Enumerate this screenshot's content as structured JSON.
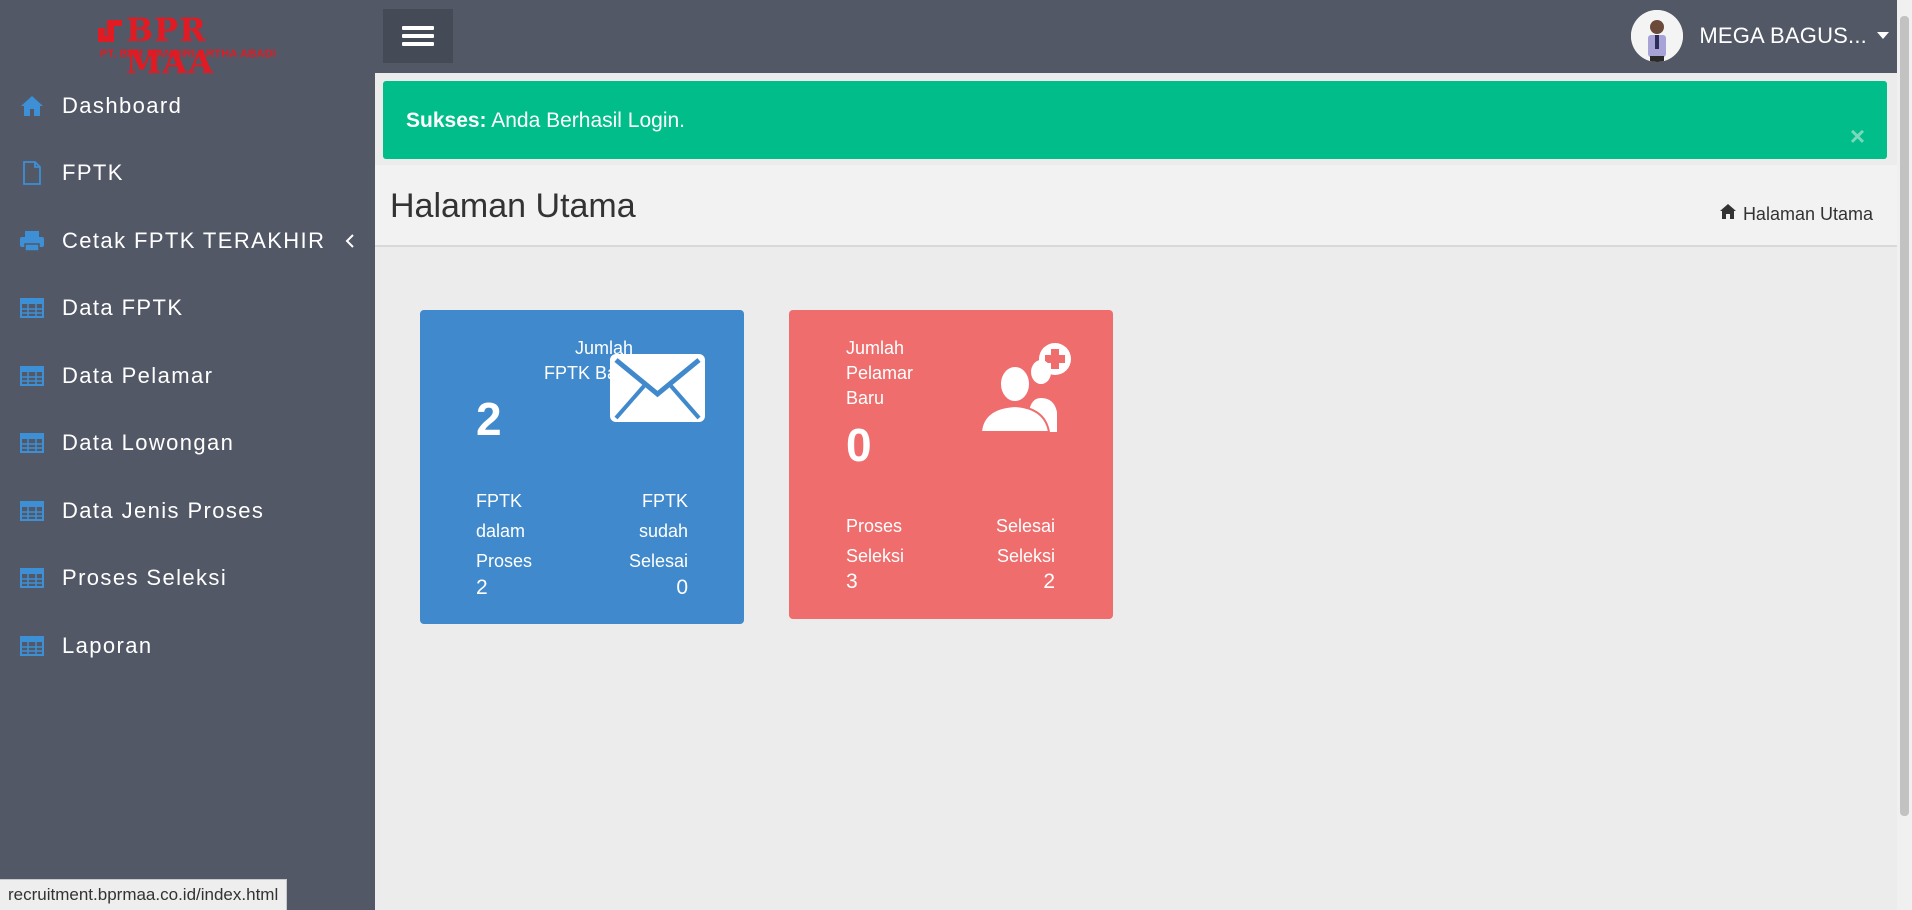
{
  "app": {
    "logo_title": "BPR MAA",
    "logo_subtitle": "PT. BPR MANDIRI ARTHA ABADI"
  },
  "colors": {
    "sidebar_bg": "#525866",
    "accent_icon": "#3d8fd6",
    "success": "#00bd8a",
    "card_blue": "#3f89cc",
    "card_red": "#ef6d6d"
  },
  "sidebar": {
    "items": [
      {
        "label": "Dashboard",
        "icon": "home-icon"
      },
      {
        "label": "FPTK",
        "icon": "file-icon"
      },
      {
        "label": "Cetak FPTK TERAKHIR",
        "icon": "printer-icon"
      },
      {
        "label": "Data FPTK",
        "icon": "table-icon"
      },
      {
        "label": "Data Pelamar",
        "icon": "table-icon"
      },
      {
        "label": "Data Lowongan",
        "icon": "table-icon"
      },
      {
        "label": "Data Jenis Proses",
        "icon": "table-icon"
      },
      {
        "label": "Proses Seleksi",
        "icon": "table-icon"
      },
      {
        "label": "Laporan",
        "icon": "table-icon"
      }
    ]
  },
  "topbar": {
    "user_name": "MEGA BAGUS..."
  },
  "alert": {
    "strong": "Sukses:",
    "message": " Anda Berhasil Login.",
    "close": "×"
  },
  "header": {
    "title": "Halaman Utama",
    "breadcrumb": "Halaman Utama"
  },
  "cards": {
    "fptk": {
      "title_line1": "Jumlah",
      "title_line2": "FPTK Baru",
      "count": "2",
      "left_label": [
        "FPTK",
        "dalam",
        "Proses"
      ],
      "left_value": "2",
      "right_label": [
        "FPTK",
        "sudah",
        "Selesai"
      ],
      "right_value": "0"
    },
    "pelamar": {
      "title_line1": "Jumlah",
      "title_line2": "Pelamar",
      "title_line3": "Baru",
      "count": "0",
      "left_label": [
        "Proses",
        "Seleksi"
      ],
      "left_value": "3",
      "right_label": [
        "Selesai",
        "Seleksi"
      ],
      "right_value": "2"
    }
  },
  "statusbar": {
    "url": "recruitment.bprmaa.co.id/index.html"
  }
}
